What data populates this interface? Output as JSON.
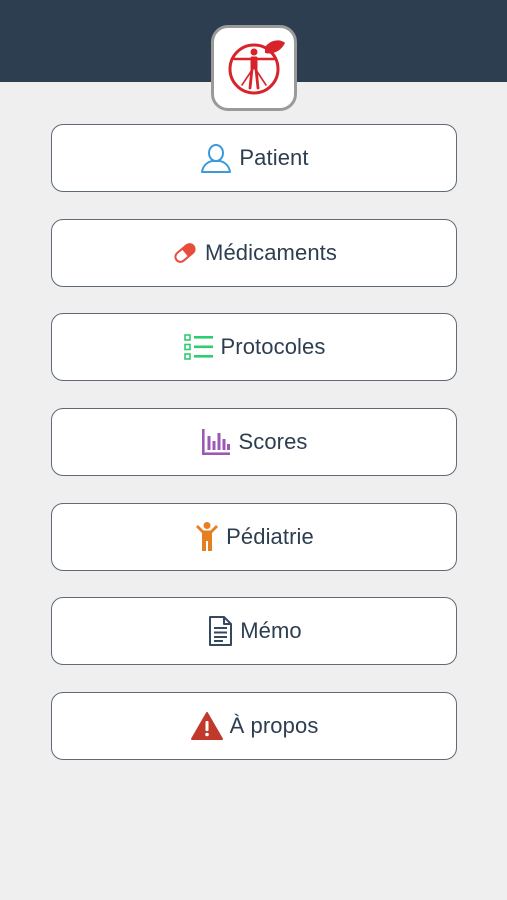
{
  "colors": {
    "header": "#2d3e50",
    "background": "#efefef",
    "button_border": "#5f6a76",
    "label": "#2d3e50",
    "logo_red": "#d8232a"
  },
  "logo": {
    "icon": "vitruvian-man-logo-icon"
  },
  "menu": {
    "items": [
      {
        "label": "Patient",
        "icon": "person-outline-icon",
        "color": "#3b9ad9"
      },
      {
        "label": "Médicaments",
        "icon": "pill-icon",
        "color": "#e74c3c"
      },
      {
        "label": "Protocoles",
        "icon": "checklist-icon",
        "color": "#2ecc71"
      },
      {
        "label": "Scores",
        "icon": "bar-chart-icon",
        "color": "#9b59b6"
      },
      {
        "label": "Pédiatrie",
        "icon": "child-icon",
        "color": "#e67e22"
      },
      {
        "label": "Mémo",
        "icon": "document-icon",
        "color": "#34495e"
      },
      {
        "label": "À propos",
        "icon": "warning-triangle-icon",
        "color": "#c0392b"
      }
    ]
  }
}
